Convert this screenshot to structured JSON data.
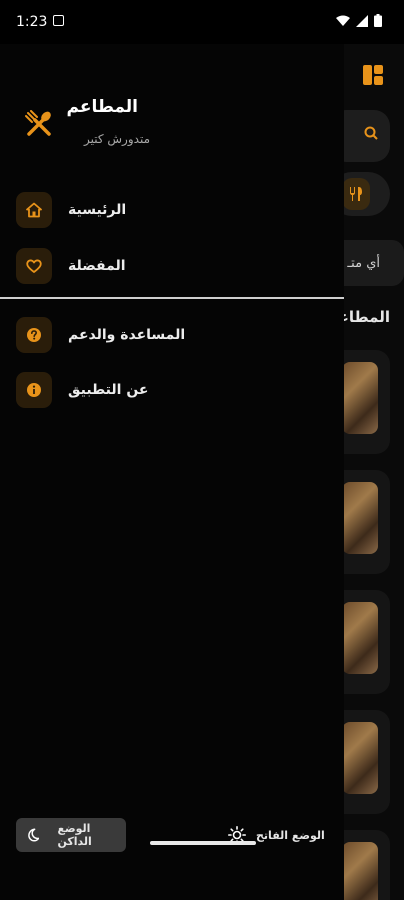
{
  "status_bar": {
    "time": "1:23"
  },
  "drawer": {
    "app_name": "المطاعم",
    "subtitle": "متدورش كتير",
    "menu": [
      {
        "label": "الرئيسية",
        "icon": "home-icon"
      },
      {
        "label": "المفضلة",
        "icon": "heart-icon"
      },
      {
        "label": "المساعدة والدعم",
        "icon": "help-icon"
      },
      {
        "label": "عن التطبيق",
        "icon": "info-icon"
      }
    ],
    "theme": {
      "dark_label": "الوضع الداكن",
      "light_label": "الوضع الفاتح"
    }
  },
  "background": {
    "search_hint": "أي متـ",
    "section_title": "المطاعـ"
  },
  "colors": {
    "accent": "#E8931A",
    "drawer_bg": "#050505",
    "icon_box": "#2A1D0A"
  }
}
